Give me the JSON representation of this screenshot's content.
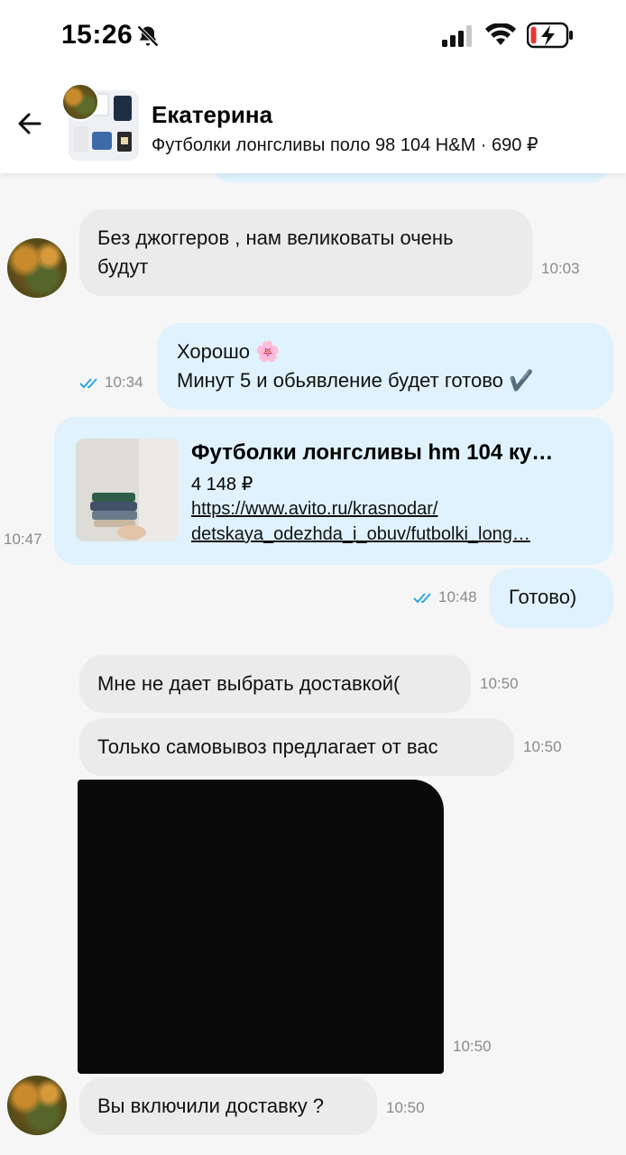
{
  "status_bar": {
    "time": "15:26",
    "icons": [
      "bell-muted-icon",
      "signal-icon",
      "wifi-icon",
      "battery-charging-icon"
    ]
  },
  "header": {
    "name": "Екатерина",
    "subtitle": "Футболки лонгсливы поло 98 104 H&M · 690 ₽",
    "back_icon": "arrow-left-icon"
  },
  "messages": [
    {
      "direction": "in",
      "text_line1": "Без джоггеров , нам великоваты очень",
      "text_line2": "будут",
      "time": "10:03"
    },
    {
      "direction": "out",
      "text_line1": "Хорошо 🌸",
      "text_line2": "Минут 5 и обьявление будет готово ✔️",
      "time": "10:34",
      "read": true
    },
    {
      "direction": "out",
      "type": "listing_card",
      "title": "Футболки лонгсливы hm 104 ку…",
      "price": "4 148 ₽",
      "url_line1": "https://www.avito.ru/krasnodar/",
      "url_line2": "detskaya_odezhda_i_obuv/futbolki_long…",
      "time": "10:47"
    },
    {
      "direction": "out",
      "text": "Готово)",
      "time": "10:48",
      "read": true
    },
    {
      "direction": "in",
      "text": "Мне не дает выбрать доставкой(",
      "time": "10:50"
    },
    {
      "direction": "in",
      "text": "Только самовывоз предлагает от вас",
      "time": "10:50"
    },
    {
      "direction": "in",
      "type": "image",
      "time": "10:50"
    },
    {
      "direction": "in",
      "text": "Вы включили доставку ?",
      "time": "10:50"
    }
  ],
  "colors": {
    "incoming_bubble": "#ebebeb",
    "outgoing_bubble": "#dff2fd",
    "read_ticks": "#2aa7e6"
  }
}
